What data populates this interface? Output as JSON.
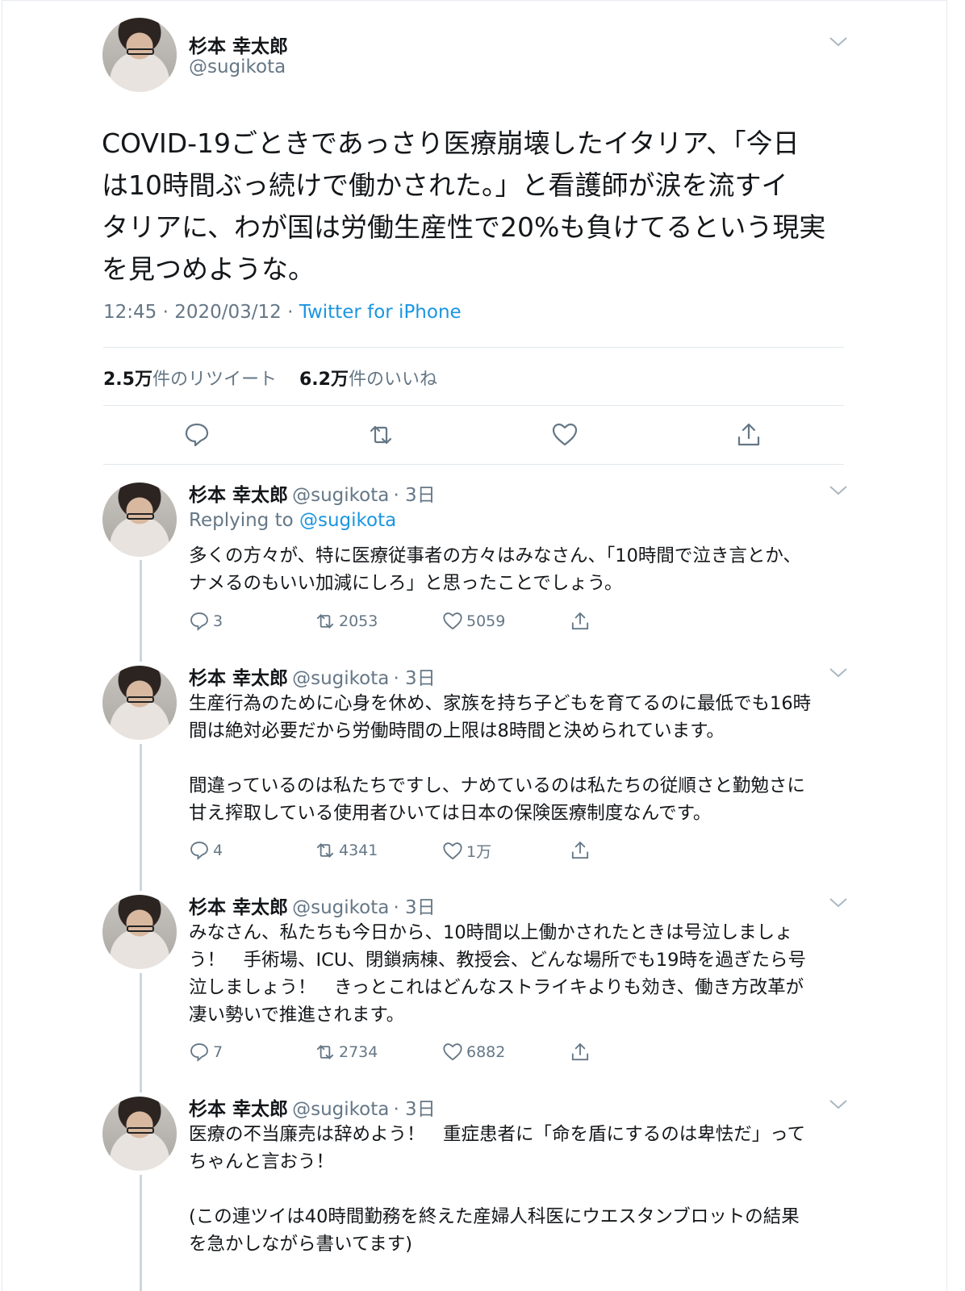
{
  "author": {
    "name": "杉本 幸太郎",
    "handle": "@sugikota"
  },
  "main_tweet": {
    "lines": [
      "COVID-19ごときであっさり医療崩壊したイタリア、「今日",
      "は10時間ぶっ続けで働かされた。」と看護師が涙を流すイ",
      "タリアに、わが国は労働生産性で20%も負けてるという現実",
      "を見つめような。"
    ],
    "time": "12:45 · 2020/03/12 · ",
    "source": "Twitter for iPhone",
    "retweets_value": "2.5万",
    "retweets_label": "件のリツイート",
    "likes_value": "6.2万",
    "likes_label": "件のいいね"
  },
  "replies": [
    {
      "time": "· 3日",
      "replying_prefix": "Replying to ",
      "replying_handle": "@sugikota",
      "lines": [
        "多くの方々が、特に医療従事者の方々はみなさん、「10時間で泣き言とか、",
        "ナメるのもいい加減にしろ」と思ったことでしょう。"
      ],
      "replies": "3",
      "retweets": "2053",
      "likes": "5059"
    },
    {
      "time": "· 3日",
      "lines": [
        "生産行為のために心身を休め、家族を持ち子どもを育てるのに最低でも16時",
        "間は絶対必要だから労働時間の上限は8時間と決められています。",
        "",
        "間違っているのは私たちですし、ナめているのは私たちの従順さと勤勉さに",
        "甘え搾取している使用者ひいては日本の保険医療制度なんです。"
      ],
      "replies": "4",
      "retweets": "4341",
      "likes": "1万"
    },
    {
      "time": "· 3日",
      "lines": [
        "みなさん、私たちも今日から、10時間以上働かされたときは号泣しましょ",
        "う！　手術場、ICU、閉鎖病棟、教授会、どんな場所でも19時を過ぎたら号",
        "泣しましょう！　きっとこれはどんなストライキよりも効き、働き方改革が",
        "凄い勢いで推進されます。"
      ],
      "replies": "7",
      "retweets": "2734",
      "likes": "6882"
    },
    {
      "time": "· 3日",
      "lines": [
        "医療の不当廉売は辞めよう！　重症患者に「命を盾にするのは卑怯だ」って",
        "ちゃんと言おう！",
        "",
        "(この連ツイは40時間勤務を終えた産婦人科医にウエスタンブロットの結果",
        "を急かしながら書いてます)"
      ]
    }
  ]
}
